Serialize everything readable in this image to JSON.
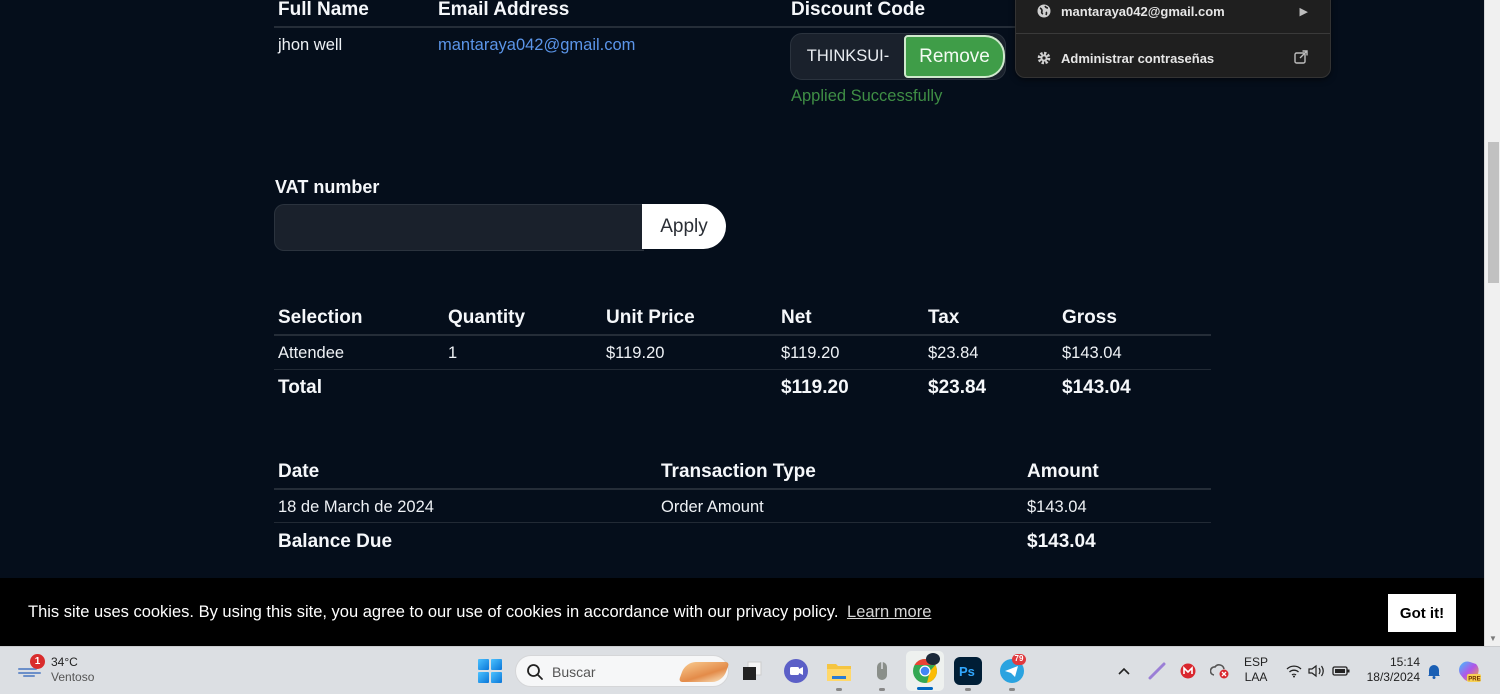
{
  "attendee_table": {
    "headers": [
      "Full Name",
      "Email Address",
      "Discount Code"
    ],
    "row": {
      "full_name": "jhon well",
      "email": "mantaraya042@gmail.com"
    },
    "discount": {
      "code_value": "THINKSUI-",
      "remove_label": "Remove",
      "status": "Applied Successfully"
    }
  },
  "password_popup": {
    "account": "mantaraya042@gmail.com",
    "manage_label": "Administrar contraseñas"
  },
  "vat": {
    "label": "VAT number",
    "value": "",
    "placeholder": "",
    "apply_label": "Apply"
  },
  "order_table": {
    "headers": [
      "Selection",
      "Quantity",
      "Unit Price",
      "Net",
      "Tax",
      "Gross"
    ],
    "rows": [
      {
        "selection": "Attendee",
        "quantity": "1",
        "unit_price": "$119.20",
        "net": "$119.20",
        "tax": "$23.84",
        "gross": "$143.04"
      }
    ],
    "total": {
      "label": "Total",
      "net": "$119.20",
      "tax": "$23.84",
      "gross": "$143.04"
    }
  },
  "transaction_table": {
    "headers": [
      "Date",
      "Transaction Type",
      "Amount"
    ],
    "rows": [
      {
        "date": "18 de March de 2024",
        "type": "Order Amount",
        "amount": "$143.04"
      }
    ],
    "balance": {
      "label": "Balance Due",
      "amount": "$143.04"
    }
  },
  "cookie_banner": {
    "text": "This site uses cookies. By using this site, you agree to our use of cookies in accordance with our privacy policy.",
    "link_label": "Learn more",
    "button_label": "Got it!"
  },
  "taskbar": {
    "weather": {
      "temp": "34°C",
      "desc": "Ventoso",
      "badge": "1"
    },
    "search_placeholder": "Buscar",
    "apps": [
      "task-view",
      "meet",
      "file-explorer",
      "mouse-app",
      "chrome",
      "photoshop",
      "telegram"
    ],
    "telegram_badge": "79",
    "language": {
      "line1": "ESP",
      "line2": "LAA"
    },
    "clock": {
      "time": "15:14",
      "date": "18/3/2024"
    },
    "copilot_badge": "PRE"
  }
}
